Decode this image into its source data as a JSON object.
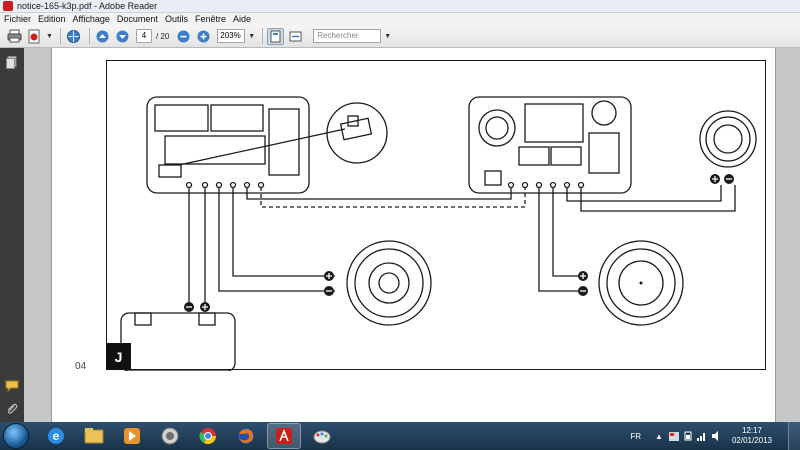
{
  "window": {
    "title": "notice-165-k3p.pdf - Adobe Reader"
  },
  "menu": {
    "items": [
      "Fichier",
      "Edition",
      "Affichage",
      "Document",
      "Outils",
      "Fenêtre",
      "Aide"
    ]
  },
  "toolbar": {
    "current_page": "4",
    "total_pages": "/ 20",
    "zoom": "203%",
    "search_placeholder": "Rechercher"
  },
  "document": {
    "page_number": "04",
    "figure_label": "J"
  },
  "taskbar": {
    "apps": [
      "internet-explorer",
      "file-explorer",
      "media-player",
      "itunes",
      "chrome",
      "firefox",
      "adobe-reader",
      "paint"
    ],
    "active_app": "adobe-reader",
    "language": "FR",
    "time": "12:17",
    "date": "02/01/2013"
  },
  "colors": {
    "reader_red": "#c8201e",
    "nav_panel": "#3b3b3b",
    "taskbar": "#19334a"
  }
}
